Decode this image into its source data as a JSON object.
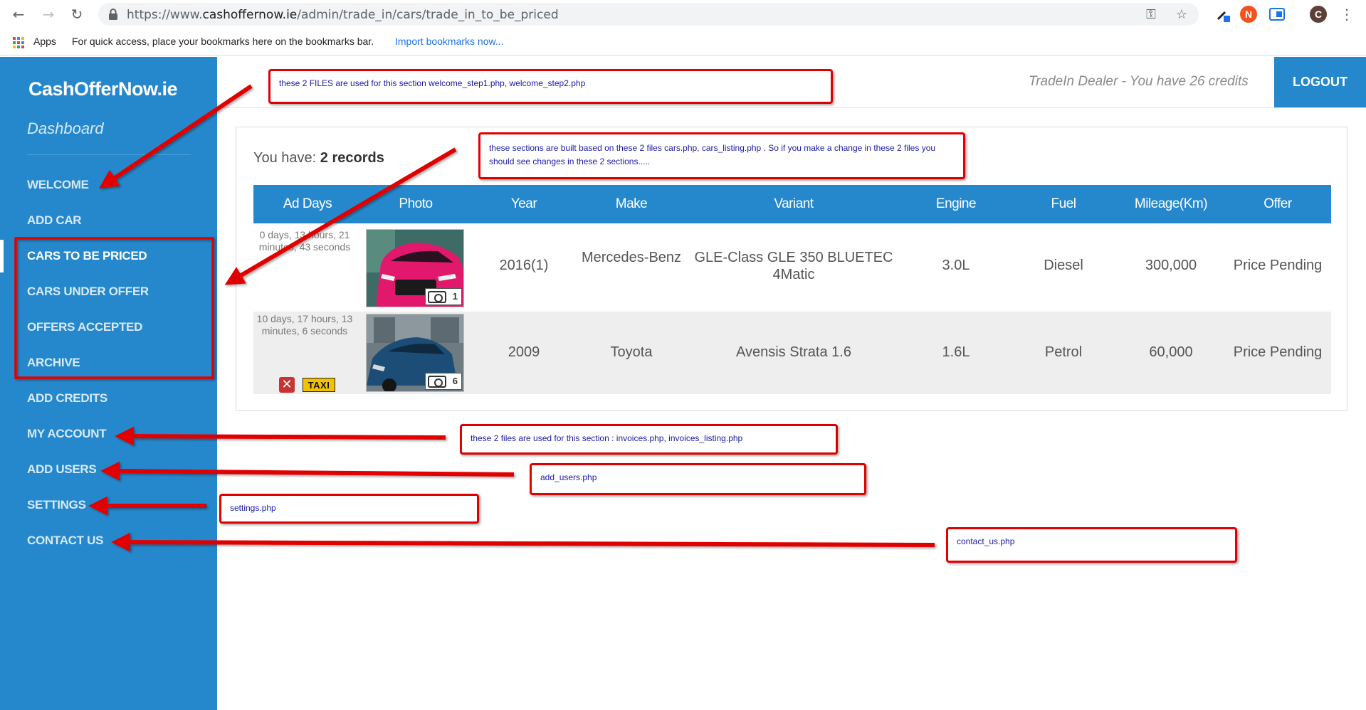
{
  "browser": {
    "url_prefix": "https://www.",
    "url_host": "cashoffernow.ie",
    "url_path": "/admin/trade_in/cars/trade_in_to_be_priced",
    "profile_initial": "C",
    "ext_n": "N",
    "bookmarks_apps": "Apps",
    "bookmarks_hint": "For quick access, place your bookmarks here on the bookmarks bar.",
    "bookmarks_import": "Import bookmarks now..."
  },
  "sidebar": {
    "brand": "CashOfferNow.ie",
    "dashboard": "Dashboard",
    "items": [
      {
        "label": "WELCOME"
      },
      {
        "label": "ADD CAR"
      },
      {
        "label": "CARS TO BE PRICED"
      },
      {
        "label": "CARS UNDER OFFER"
      },
      {
        "label": "OFFERS ACCEPTED"
      },
      {
        "label": "ARCHIVE"
      },
      {
        "label": "ADD CREDITS"
      },
      {
        "label": "MY ACCOUNT"
      },
      {
        "label": "ADD USERS"
      },
      {
        "label": "SETTINGS"
      },
      {
        "label": "CONTACT US"
      }
    ],
    "active_index": 2
  },
  "header": {
    "dealer_text": "TradeIn Dealer - You have 26 credits",
    "logout": "LOGOUT"
  },
  "records": {
    "prefix": "You have: ",
    "count": "2 records"
  },
  "table": {
    "headers": [
      "Ad Days",
      "Photo",
      "Year",
      "Make",
      "Variant",
      "Engine",
      "Fuel",
      "Mileage(Km)",
      "Offer"
    ],
    "rows": [
      {
        "ad_days": "0 days, 13 hours, 21 minutes, 43 seconds",
        "photo_count": "1",
        "year": "2016(1)",
        "make": "Mercedes-Benz",
        "variant": "GLE-Class GLE 350 BLUETEC 4Matic",
        "engine": "3.0L",
        "fuel": "Diesel",
        "mileage": "300,000",
        "offer": "Price Pending"
      },
      {
        "ad_days": "10 days, 17 hours, 13 minutes, 6 seconds",
        "photo_count": "6",
        "year": "2009",
        "make": "Toyota",
        "variant": "Avensis Strata 1.6",
        "engine": "1.6L",
        "fuel": "Petrol",
        "mileage": "60,000",
        "offer": "Price Pending",
        "badge_x": "✕",
        "badge_taxi": "TAXI"
      }
    ]
  },
  "annotations": {
    "welcome": "these 2 FILES are used for this section welcome_step1.php, welcome_step2.php",
    "cars": "these sections are built based on these 2 files cars.php, cars_listing.php . So if you make a change in these 2 files you should see changes in these 2 sections.....",
    "invoices": "these 2 files are used for this section : invoices.php, invoices_listing.php",
    "add_users": "add_users.php",
    "settings": "settings.php",
    "contact": "contact_us.php"
  },
  "colors": {
    "primary_blue": "#2688cc",
    "annotation_red": "#e00000",
    "annotation_text": "#1a1aa6"
  }
}
